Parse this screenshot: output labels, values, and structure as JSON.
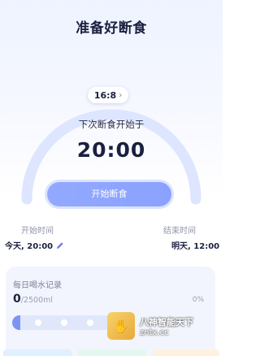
{
  "header": {
    "title": "准备好断食"
  },
  "fasting": {
    "plan": "16:8",
    "plan_chevron": "›",
    "next_label": "下次断食开始于",
    "next_time": "20:00",
    "start_button": "开始断食"
  },
  "schedule": {
    "start_label": "开始时间",
    "start_value": "今天, 20:00",
    "end_label": "结束时间",
    "end_value": "明天, 12:00"
  },
  "water": {
    "title": "每日喝水记录",
    "current": "0",
    "goal": "/2500ml",
    "percent": "0%",
    "progress_fraction": 0
  },
  "watermark": {
    "logo_glyph": "✋",
    "text_cn": "八神智能天下",
    "text_en": "zntx.cc"
  },
  "colors": {
    "accent": "#8aa2ff",
    "ring": "#dde5ff",
    "title": "#1b2040"
  }
}
